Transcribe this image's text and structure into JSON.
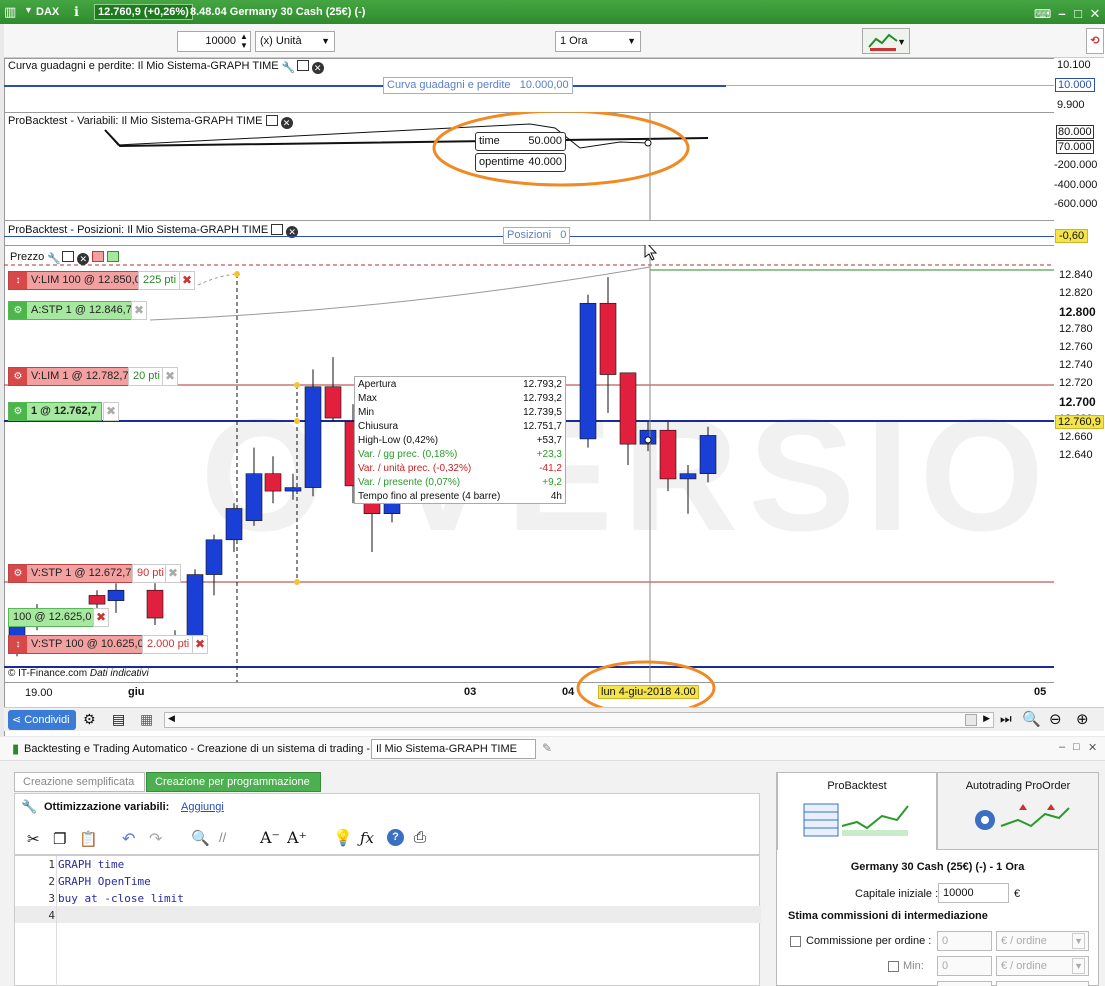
{
  "titlebar": {
    "symbol": "DAX",
    "price": "12.760,9 (+0,26%)",
    "description": "8.48.04 Germany 30 Cash (25€) (-)"
  },
  "toolbar": {
    "quantity": "10000",
    "unit": "(x) Unità",
    "timeframe": "1 Ora"
  },
  "equity_panel": {
    "header": "Curva guadagni e perdite: Il Mio Sistema-GRAPH TIME",
    "label": "Curva guadagni e perdite   10.000,00",
    "axis": [
      "10.100",
      "10.000",
      "9.900"
    ]
  },
  "variables_panel": {
    "header": "ProBacktest - Variabili: Il Mio Sistema-GRAPH TIME",
    "legend": [
      {
        "name": "time",
        "value": "50.000"
      },
      {
        "name": "opentime",
        "value": "40.000"
      }
    ],
    "axis": [
      "80.000",
      "70.000",
      "-200.000",
      "-400.000",
      "-600.000"
    ]
  },
  "positions_panel": {
    "header": "ProBacktest - Posizioni: Il Mio Sistema-GRAPH TIME",
    "label": "Posizioni   0",
    "axis_value": "-0,60"
  },
  "price_panel": {
    "header": "Prezzo",
    "axis": [
      "12.840",
      "12.820",
      "12.800",
      "12.780",
      "12.760",
      "12.740",
      "12.720",
      "12.700",
      "12.680",
      "12.660",
      "12.640"
    ],
    "current_price": "12.760,9",
    "watermark": "O VERSIO",
    "copyright": "© IT-Finance.com",
    "copyright_note": "Dati indicativi",
    "orders": [
      {
        "label": "V:LIM  100 @ 12.850,0",
        "pts": "225 pti",
        "type": "red"
      },
      {
        "label": "A:STP  1 @ 12.846,7",
        "pts": "",
        "type": "green"
      },
      {
        "label": "V:LIM  1 @ 12.782,7",
        "pts": "20 pti",
        "type": "red"
      },
      {
        "label": "1 @ 12.762,7",
        "pts": "",
        "type": "green"
      },
      {
        "label": "V:STP  1 @ 12.672,7",
        "pts": "90 pti",
        "type": "red"
      },
      {
        "label": "100 @ 12.625,0",
        "pts": "",
        "type": "green"
      },
      {
        "label": "V:STP  100 @ 10.625,0",
        "pts": "2.000 pti",
        "type": "red"
      }
    ],
    "tooltip": [
      {
        "k": "Apertura",
        "v": "12.793,2",
        "c": ""
      },
      {
        "k": "Max",
        "v": "12.793,2",
        "c": ""
      },
      {
        "k": "Min",
        "v": "12.739,5",
        "c": ""
      },
      {
        "k": "Chiusura",
        "v": "12.751,7",
        "c": ""
      },
      {
        "k": "High-Low (0,42%)",
        "v": "+53,7",
        "c": ""
      },
      {
        "k": "Var. / gg prec. (0,18%)",
        "v": "+23,3",
        "c": "g"
      },
      {
        "k": "Var. / unità prec. (-0,32%)",
        "v": "-41,2",
        "c": "r"
      },
      {
        "k": "Var. / presente (0,07%)",
        "v": "+9,2",
        "c": "g"
      },
      {
        "k": "Tempo fino al presente (4 barre)",
        "v": "4h",
        "c": ""
      }
    ],
    "x_labels": [
      "19.00",
      "giu",
      "03",
      "04",
      "05"
    ],
    "cursor_date": "lun 4-giu-2018 4.00"
  },
  "chart_data": {
    "type": "candlestick",
    "ylim": [
      12625,
      12855
    ],
    "candles": [
      {
        "o": 12638,
        "h": 12650,
        "l": 12630,
        "c": 12648,
        "d": "up"
      },
      {
        "o": 12650,
        "h": 12660,
        "l": 12645,
        "c": 12655,
        "d": "up"
      },
      {
        "o": 12665,
        "h": 12668,
        "l": 12655,
        "c": 12660,
        "d": "down"
      },
      {
        "o": 12662,
        "h": 12672,
        "l": 12655,
        "c": 12668,
        "d": "up"
      },
      {
        "o": 12668,
        "h": 12672,
        "l": 12648,
        "c": 12652,
        "d": "down"
      },
      {
        "o": 12640,
        "h": 12645,
        "l": 12632,
        "c": 12635,
        "d": "down"
      },
      {
        "o": 12638,
        "h": 12680,
        "l": 12635,
        "c": 12677,
        "d": "up"
      },
      {
        "o": 12677,
        "h": 12700,
        "l": 12665,
        "c": 12697,
        "d": "up"
      },
      {
        "o": 12697,
        "h": 12718,
        "l": 12690,
        "c": 12715,
        "d": "up"
      },
      {
        "o": 12708,
        "h": 12750,
        "l": 12705,
        "c": 12735,
        "d": "up"
      },
      {
        "o": 12735,
        "h": 12745,
        "l": 12718,
        "c": 12725,
        "d": "down"
      },
      {
        "o": 12725,
        "h": 12735,
        "l": 12720,
        "c": 12727,
        "d": "up"
      },
      {
        "o": 12727,
        "h": 12795,
        "l": 12722,
        "c": 12785,
        "d": "up"
      },
      {
        "o": 12785,
        "h": 12802,
        "l": 12765,
        "c": 12767,
        "d": "down"
      },
      {
        "o": 12765,
        "h": 12775,
        "l": 12718,
        "c": 12728,
        "d": "down"
      },
      {
        "o": 12728,
        "h": 12745,
        "l": 12690,
        "c": 12712,
        "d": "down"
      },
      {
        "o": 12712,
        "h": 12730,
        "l": 12707,
        "c": 12718,
        "d": "up"
      },
      {
        "o": 12757,
        "h": 12768,
        "l": 12752,
        "c": 12762,
        "d": "up"
      },
      {
        "o": 12762,
        "h": 12770,
        "l": 12755,
        "c": 12765,
        "d": "up"
      },
      {
        "o": 12767,
        "h": 12772,
        "l": 12755,
        "c": 12760,
        "d": "up"
      },
      {
        "o": 12760,
        "h": 12770,
        "l": 12755,
        "c": 12768,
        "d": "up"
      },
      {
        "o": 12767,
        "h": 12770,
        "l": 12755,
        "c": 12760,
        "d": "down"
      },
      {
        "o": 12755,
        "h": 12838,
        "l": 12750,
        "c": 12833,
        "d": "up"
      },
      {
        "o": 12833,
        "h": 12848,
        "l": 12770,
        "c": 12792,
        "d": "down"
      },
      {
        "o": 12793,
        "h": 12793,
        "l": 12740,
        "c": 12752,
        "d": "down"
      },
      {
        "o": 12752,
        "h": 12765,
        "l": 12748,
        "c": 12760,
        "d": "up"
      },
      {
        "o": 12760,
        "h": 12765,
        "l": 12725,
        "c": 12732,
        "d": "down"
      },
      {
        "o": 12732,
        "h": 12740,
        "l": 12712,
        "c": 12735,
        "d": "up"
      },
      {
        "o": 12735,
        "h": 12762,
        "l": 12730,
        "c": 12757,
        "d": "up"
      }
    ]
  },
  "bottom_toolbar": {
    "share_label": "Condividi"
  },
  "lower_window": {
    "title": "Backtesting e Trading Automatico - Creazione di un sistema di trading  -",
    "system_name": "Il Mio Sistema-GRAPH TIME",
    "tabs": [
      "Creazione semplificata",
      "Creazione per programmazione"
    ],
    "optimization_label": "Ottimizzazione variabili:",
    "optimization_link": "Aggiungi",
    "code_lines": [
      "GRAPH time",
      "GRAPH OpenTime",
      "buy at -close limit",
      ""
    ],
    "right_tabs": [
      "ProBacktest",
      "Autotrading ProOrder"
    ],
    "instrument": "Germany 30 Cash (25€) (-) - 1 Ora",
    "capital_label": "Capitale iniziale :",
    "capital_value": "10000",
    "currency": "€",
    "commission_title": "Stima commissioni di intermediazione",
    "commission_order_label": "Commissione per ordine :",
    "commission_order_value": "0",
    "commission_order_unit": "€ / ordine",
    "min_label": "Min:",
    "min_value": "0",
    "min_unit": "€ / ordine"
  }
}
